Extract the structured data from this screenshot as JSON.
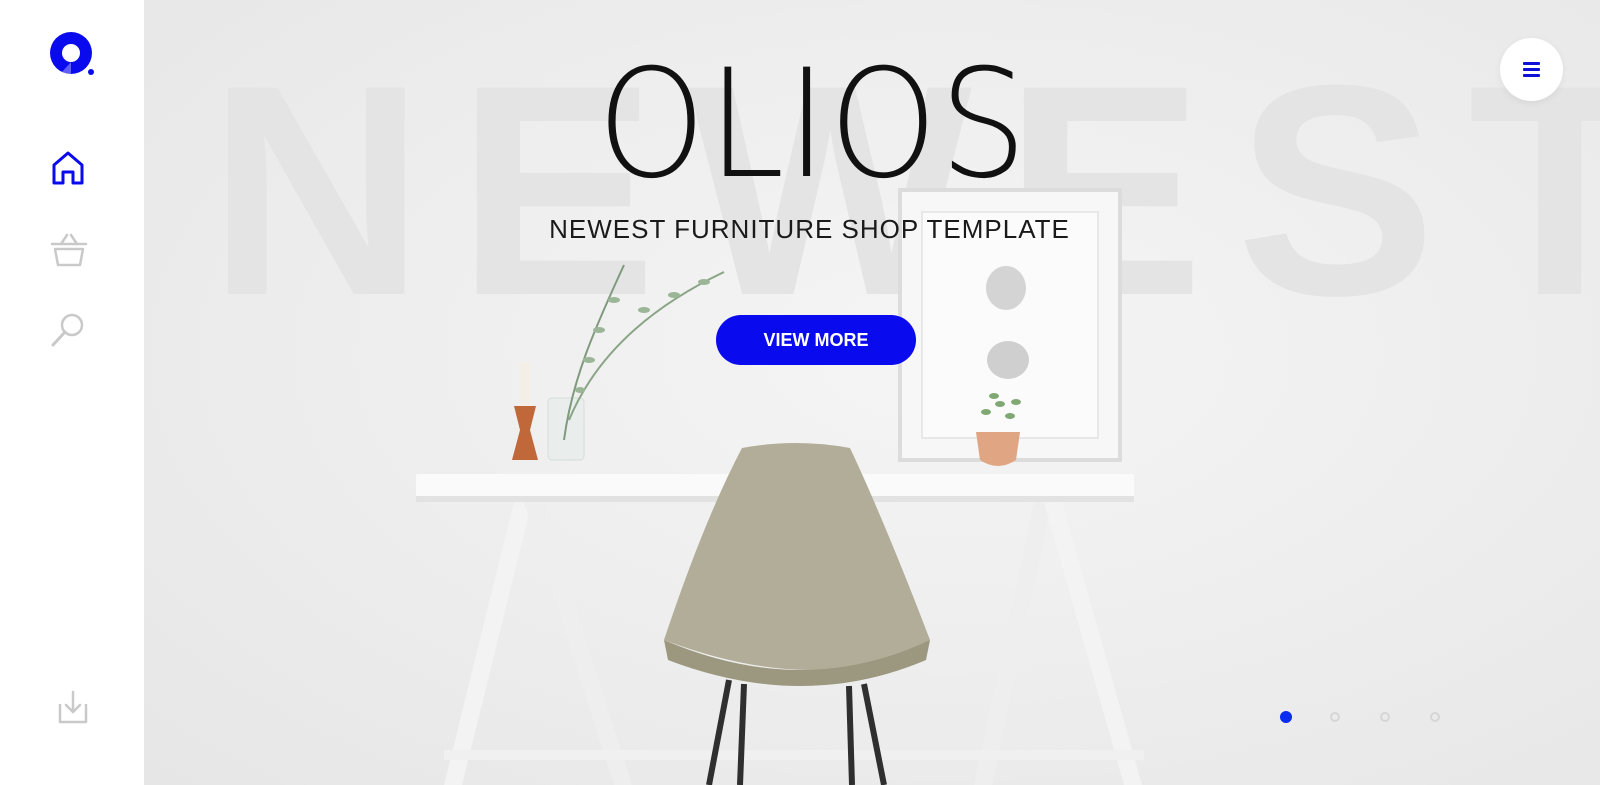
{
  "brand": {
    "logo_icon": "olios-logo-icon",
    "accent_color": "#0a0aee"
  },
  "sidebar": {
    "items": [
      {
        "name": "home",
        "icon": "home-icon",
        "active": true
      },
      {
        "name": "shop",
        "icon": "basket-icon",
        "active": false
      },
      {
        "name": "search",
        "icon": "search-icon",
        "active": false
      }
    ],
    "bottom": {
      "icon": "download-icon"
    }
  },
  "hero": {
    "watermark": "NEWEST",
    "title": "OLIOS",
    "tagline": "NEWEST FURNITURE SHOP TEMPLATE",
    "cta_label": "VIEW MORE"
  },
  "menu": {
    "icon": "hamburger-menu-icon"
  },
  "slider": {
    "slide_count": 4,
    "active_index": 0
  }
}
